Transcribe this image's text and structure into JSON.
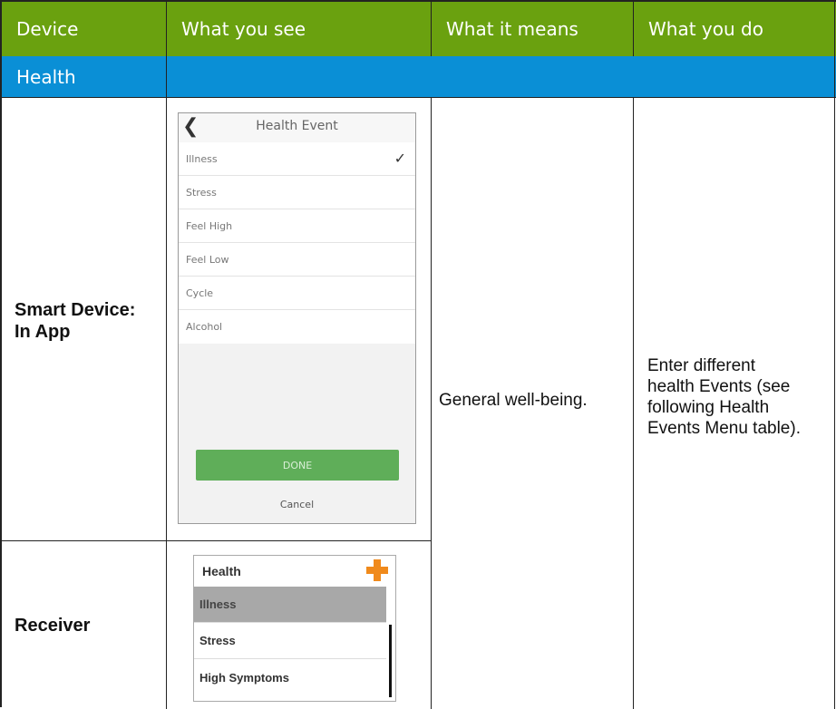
{
  "headers": {
    "device": "Device",
    "what_you_see": "What you see",
    "what_it_means": "What it means",
    "what_you_do": "What you do"
  },
  "section": "Health",
  "rows": {
    "smart_device": {
      "label_line1": "Smart Device:",
      "label_line2": "In App"
    },
    "receiver": {
      "label": "Receiver"
    }
  },
  "meaning": "General well-being.",
  "action_lines": [
    "Enter different",
    "health Events (see",
    "following Health",
    "Events Menu table)."
  ],
  "phone_screen": {
    "back_icon": "chevron-left-icon",
    "title": "Health Event",
    "items": [
      "Illness",
      "Stress",
      "Feel High",
      "Feel Low",
      "Cycle",
      "Alcohol"
    ],
    "selected_item": "Illness",
    "check_icon": "checkmark-icon",
    "done_label": "DONE",
    "cancel_label": "Cancel"
  },
  "receiver_screen": {
    "title": "Health",
    "plus_icon": "plus-icon",
    "items": [
      "Illness",
      "Stress",
      "High Symptoms"
    ],
    "selected_item": "Illness"
  },
  "colors": {
    "header_green": "#6aa10f",
    "section_blue": "#0a8fd6",
    "done_green": "#5fae59",
    "plus_orange": "#f08a1c"
  }
}
